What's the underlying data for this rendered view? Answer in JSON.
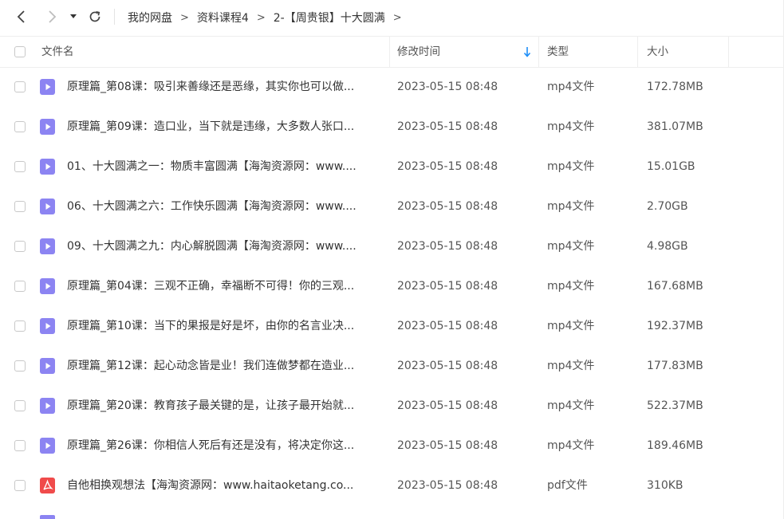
{
  "toolbar": {
    "back_icon": "chevron-left-icon",
    "forward_icon": "chevron-right-icon",
    "history_icon": "caret-down-icon",
    "refresh_icon": "refresh-icon"
  },
  "breadcrumb": [
    "我的网盘",
    "资料课程4",
    "2-【周贵银】十大圆满"
  ],
  "breadcrumb_separator": ">",
  "columns": {
    "name": "文件名",
    "modified": "修改时间",
    "type": "类型",
    "size": "大小"
  },
  "sort": {
    "column": "modified",
    "direction": "descending",
    "color": "#1e8ef7"
  },
  "colors": {
    "video_icon": "#8c84f2",
    "pdf_icon": "#f04b4b"
  },
  "files": [
    {
      "name": "原理篇_第08课：吸引来善缘还是恶缘，其实你也可以做...",
      "modified": "2023-05-15 08:48",
      "type": "mp4文件",
      "size": "172.78MB",
      "icon": "video-file-icon"
    },
    {
      "name": "原理篇_第09课：造口业，当下就是违缘，大多数人张口...",
      "modified": "2023-05-15 08:48",
      "type": "mp4文件",
      "size": "381.07MB",
      "icon": "video-file-icon"
    },
    {
      "name": "01、十大圆满之一：物质丰富圆满【海淘资源网：www....",
      "modified": "2023-05-15 08:48",
      "type": "mp4文件",
      "size": "15.01GB",
      "icon": "video-file-icon"
    },
    {
      "name": "06、十大圆满之六：工作快乐圆满【海淘资源网：www....",
      "modified": "2023-05-15 08:48",
      "type": "mp4文件",
      "size": "2.70GB",
      "icon": "video-file-icon"
    },
    {
      "name": "09、十大圆满之九：内心解脱圆满【海淘资源网：www....",
      "modified": "2023-05-15 08:48",
      "type": "mp4文件",
      "size": "4.98GB",
      "icon": "video-file-icon"
    },
    {
      "name": "原理篇_第04课：三观不正确，幸福断不可得！你的三观...",
      "modified": "2023-05-15 08:48",
      "type": "mp4文件",
      "size": "167.68MB",
      "icon": "video-file-icon"
    },
    {
      "name": "原理篇_第10课：当下的果报是好是坏，由你的名言业决...",
      "modified": "2023-05-15 08:48",
      "type": "mp4文件",
      "size": "192.37MB",
      "icon": "video-file-icon"
    },
    {
      "name": "原理篇_第12课：起心动念皆是业！我们连做梦都在造业...",
      "modified": "2023-05-15 08:48",
      "type": "mp4文件",
      "size": "177.83MB",
      "icon": "video-file-icon"
    },
    {
      "name": "原理篇_第20课：教育孩子最关键的是，让孩子最开始就...",
      "modified": "2023-05-15 08:48",
      "type": "mp4文件",
      "size": "522.37MB",
      "icon": "video-file-icon"
    },
    {
      "name": "原理篇_第26课：你相信人死后有还是没有，将决定你这...",
      "modified": "2023-05-15 08:48",
      "type": "mp4文件",
      "size": "189.46MB",
      "icon": "video-file-icon"
    },
    {
      "name": "自他相换观想法【海淘资源网：www.haitaoketang.co...",
      "modified": "2023-05-15 08:48",
      "type": "pdf文件",
      "size": "310KB",
      "icon": "pdf-file-icon"
    }
  ]
}
